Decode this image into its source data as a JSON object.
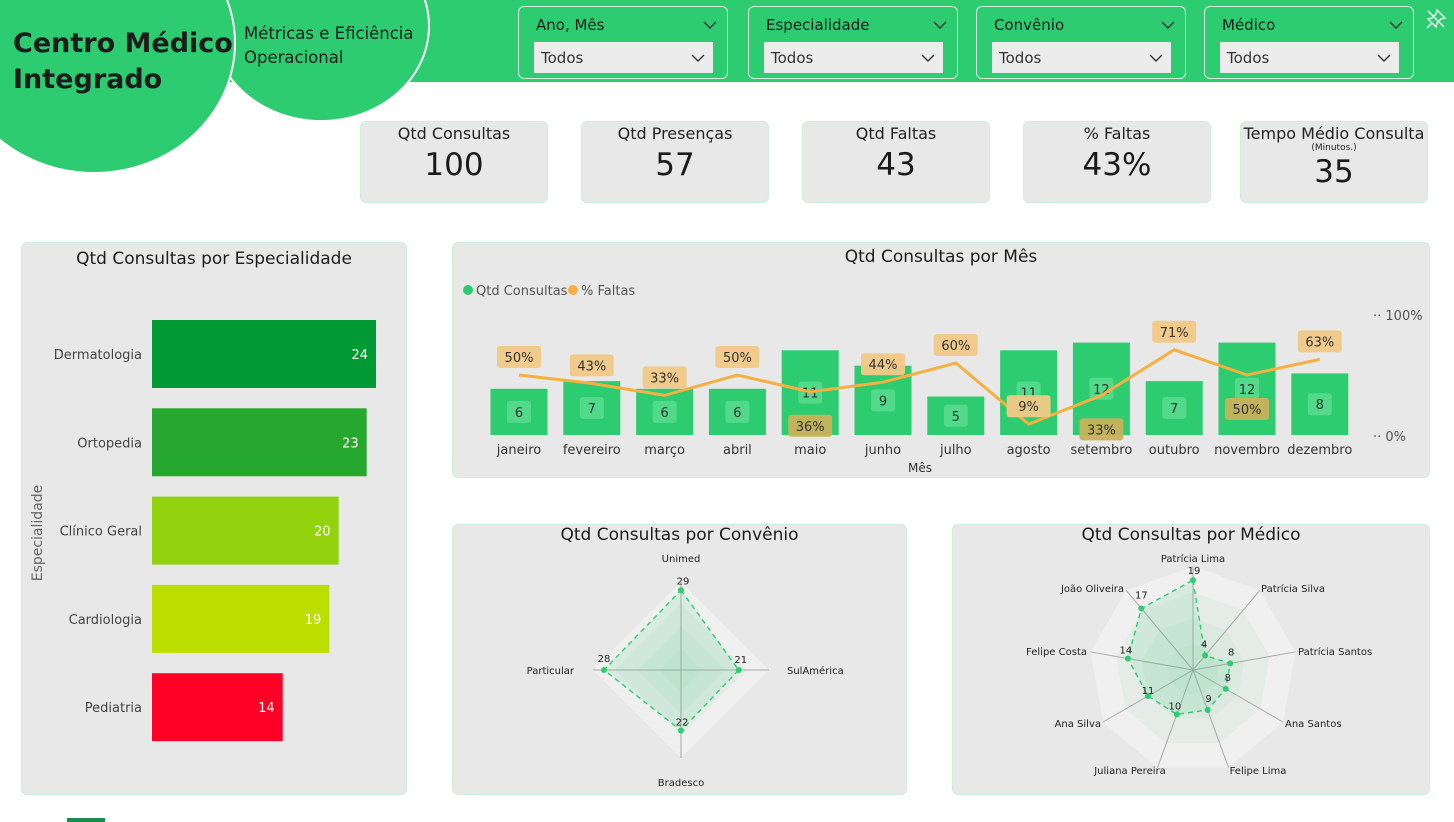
{
  "header": {
    "title_line1": "Centro Médico",
    "title_line2": "Integrado",
    "subtitle_line1": "Métricas e Eficiência",
    "subtitle_line2": "Operacional"
  },
  "filters": [
    {
      "label": "Ano, Mês",
      "value": "Todos"
    },
    {
      "label": "Especialidade",
      "value": "Todos"
    },
    {
      "label": "Convênio",
      "value": "Todos"
    },
    {
      "label": "Médico",
      "value": "Todos"
    }
  ],
  "kpis": [
    {
      "label": "Qtd Consultas",
      "value": "100",
      "sub": ""
    },
    {
      "label": "Qtd Presenças",
      "value": "57",
      "sub": ""
    },
    {
      "label": "Qtd Faltas",
      "value": "43",
      "sub": ""
    },
    {
      "label": "% Faltas",
      "value": "43%",
      "sub": ""
    },
    {
      "label": "Tempo Médio Consulta",
      "value": "35",
      "sub": "(Minutos.)"
    }
  ],
  "colors": {
    "brand": "#2ecc71",
    "panel": "#e8e8e8",
    "line": "#f5b041",
    "label_bg": "#f0c987"
  },
  "chart_data": [
    {
      "type": "bar",
      "orientation": "horizontal",
      "title": "Qtd Consultas por Especialidade",
      "ylabel": "Especialidade",
      "categories": [
        "Dermatologia",
        "Ortopedia",
        "Clínico Geral",
        "Cardiologia",
        "Pediatria"
      ],
      "values": [
        24,
        23,
        20,
        19,
        14
      ],
      "colors": [
        "#009933",
        "#26a82e",
        "#93d30d",
        "#bcdf00",
        "#ff0026"
      ],
      "xlim": [
        0,
        24
      ]
    },
    {
      "type": "bar",
      "title": "Qtd Consultas por Mês",
      "xlabel": "Mês",
      "legend_position": "top-left",
      "categories": [
        "janeiro",
        "fevereiro",
        "março",
        "abril",
        "maio",
        "junho",
        "julho",
        "agosto",
        "setembro",
        "outubro",
        "novembro",
        "dezembro"
      ],
      "series": [
        {
          "name": "Qtd Consultas",
          "type": "bar",
          "color": "#2ecc71",
          "values": [
            6,
            7,
            6,
            6,
            11,
            9,
            5,
            11,
            12,
            7,
            12,
            8
          ]
        },
        {
          "name": "% Faltas",
          "type": "line",
          "color": "#f5b041",
          "values": [
            50,
            43,
            33,
            50,
            36,
            44,
            60,
            9,
            33,
            71,
            50,
            63
          ],
          "labels": [
            "50%",
            "43%",
            "33%",
            "50%",
            "36%",
            "44%",
            "60%",
            "9%",
            "33%",
            "71%",
            "50%",
            "63%"
          ]
        }
      ],
      "y2_ticks": [
        "100%",
        "0%"
      ],
      "ylim": [
        0,
        13
      ],
      "y2lim": [
        0,
        100
      ]
    },
    {
      "type": "radar",
      "title": "Qtd Consultas por Convênio",
      "categories": [
        "Unimed",
        "SulAmérica",
        "Bradesco",
        "Particular"
      ],
      "values": [
        29,
        21,
        22,
        28
      ],
      "rmax": 32
    },
    {
      "type": "radar",
      "title": "Qtd Consultas por Médico",
      "categories": [
        "Patrícia Lima",
        "Patrícia Silva",
        "Patrícia Santos",
        "Ana Santos",
        "Felipe Lima",
        "Juliana Pereira",
        "Ana Silva",
        "Felipe Costa",
        "João Oliveira"
      ],
      "values": [
        19,
        4,
        8,
        8,
        9,
        10,
        11,
        14,
        17
      ],
      "rmax": 22
    }
  ]
}
